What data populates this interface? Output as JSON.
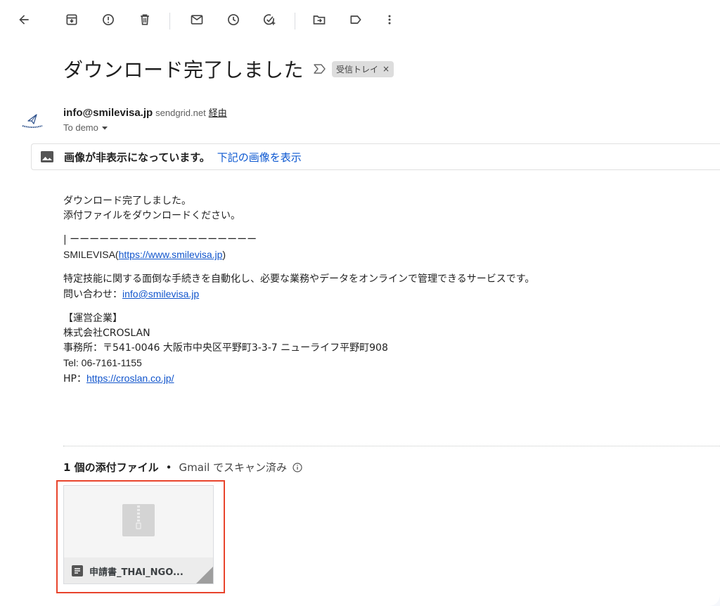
{
  "toolbar": {
    "icons": [
      "back-arrow-icon",
      "archive-icon",
      "report-spam-icon",
      "delete-icon",
      "mark-unread-icon",
      "snooze-icon",
      "add-task-icon",
      "move-to-icon",
      "label-icon",
      "more-vert-icon"
    ]
  },
  "email": {
    "subject": "ダウンロード完了しました",
    "label": "受信トレイ",
    "label_close": "×",
    "sender_email": "info@smilevisa.jp",
    "via_domain": "sendgrid.net",
    "via_text": "経由",
    "recipient": "To demo",
    "image_banner_text": "画像が非表示になっています。",
    "image_banner_link": "下記の画像を表示"
  },
  "body": {
    "line1": "ダウンロード完了しました。",
    "line2": "添付ファイルをダウンロードください。",
    "separator": "| ーーーーーーーーーーーーーーーーーーー",
    "smilevisa_prefix": "SMILEVISA(",
    "smilevisa_url": "https://www.smilevisa.jp",
    "smilevisa_suffix": ")",
    "desc": "特定技能に関する面倒な手続きを自動化し、必要な業務やデータをオンラインで管理できるサービスです。",
    "contact_prefix": "問い合わせ：",
    "contact_email": "info@smilevisa.jp",
    "company_heading": "【運営企業】",
    "company_name": "株式会社CROSLAN",
    "office": "事務所：〒541-0046 大阪市中央区平野町3-3-7 ニューライフ平野町908",
    "tel": "Tel: 06-7161-1155",
    "hp_prefix": "HP：",
    "hp_url": "https://croslan.co.jp/"
  },
  "attachments": {
    "count_text": "1 個の添付ファイル",
    "dot": "•",
    "scan_text": "Gmail でスキャン済み",
    "file_name": "申請書_THAI_NGO..."
  },
  "colors": {
    "link": "#1155cc",
    "banner_link": "#0b57d0",
    "highlight": "#e8442c"
  }
}
